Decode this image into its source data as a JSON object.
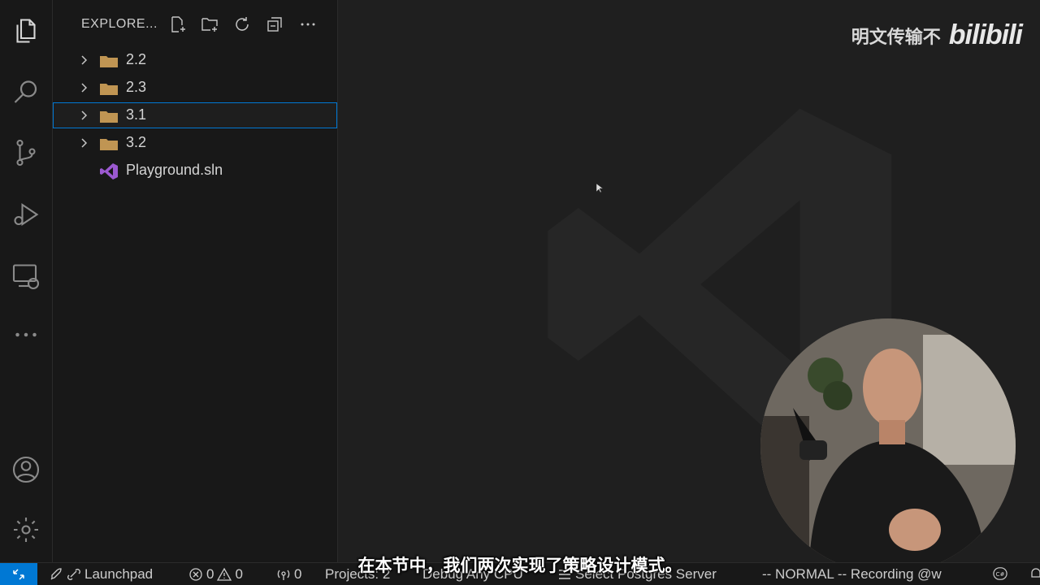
{
  "sidebar": {
    "title": "EXPLORE...",
    "items": [
      {
        "label": "2.2",
        "type": "folder"
      },
      {
        "label": "2.3",
        "type": "folder"
      },
      {
        "label": "3.1",
        "type": "folder",
        "selected": true
      },
      {
        "label": "3.2",
        "type": "folder"
      },
      {
        "label": "Playground.sln",
        "type": "solution-file"
      }
    ]
  },
  "activity_bar": [
    "files-icon",
    "search-icon",
    "source-control-icon",
    "run-debug-icon",
    "remote-explorer-icon",
    "more-icon",
    "account-icon",
    "settings-gear-icon"
  ],
  "watermark": {
    "brand_text": "明文传输不",
    "brand_logo": "bilibili"
  },
  "status_bar": {
    "launchpad": "Launchpad",
    "errors": "0",
    "warnings": "0",
    "ports": "0",
    "projects": "Projects: 2",
    "debug_config": "Debug Any CPU",
    "postgres": "Select Postgres Server",
    "vim_mode": "-- NORMAL -- Recording @w",
    "lang_badge": "C#"
  },
  "subtitle": "在本节中，我们两次实现了策略设计模式。",
  "colors": {
    "accent": "#0078d4",
    "folder": "#c09553",
    "sln": "#9b59d0",
    "background": "#1f1f1f"
  }
}
